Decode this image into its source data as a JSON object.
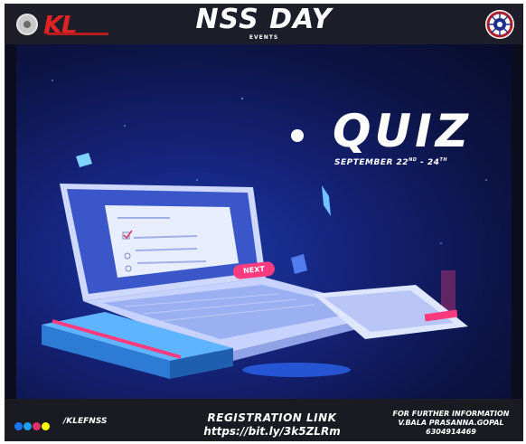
{
  "header": {
    "brand_logo_text": "KL",
    "title": "NSS DAY",
    "subtitle": "EVENTS"
  },
  "hero": {
    "heading": "QUIZ",
    "dates_prefix": "SEPTEMBER 22",
    "dates_sup1": "ND",
    "dates_mid": " - 24",
    "dates_sup2": "TH",
    "next_button_label": "NEXT"
  },
  "footer": {
    "social_icons": [
      "facebook-icon",
      "twitter-icon",
      "instagram-icon",
      "snapchat-icon"
    ],
    "social_colors": [
      "#1877f2",
      "#1da1f2",
      "#e1306c",
      "#fffc00"
    ],
    "handle": "/KLEFNSS",
    "registration_label": "REGISTRATION LINK",
    "registration_url": "https://bit.ly/3k5ZLRm",
    "info_line1": "FOR FURTHER INFORMATION",
    "info_line2": "V.BALA PRASANNA.GOPAL",
    "info_line3": "6304914469"
  },
  "colors": {
    "brand_red": "#e02424",
    "accent_pink": "#ff3b7f",
    "background_navy": "#0c1446"
  }
}
